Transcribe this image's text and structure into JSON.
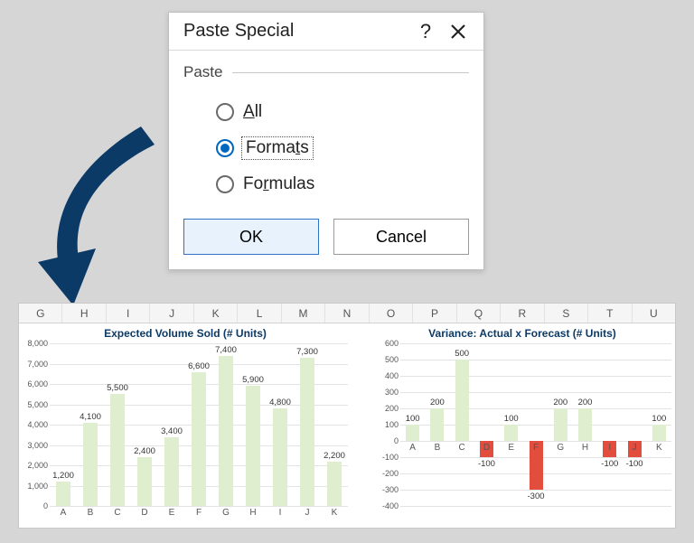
{
  "dialog": {
    "title": "Paste Special",
    "help_symbol": "?",
    "group_label": "Paste",
    "options": {
      "all": {
        "label": "All",
        "ukey": "A"
      },
      "formats": {
        "label": "Formats",
        "ukey": "t"
      },
      "formulas": {
        "label": "Formulas",
        "ukey": "r"
      }
    },
    "ok_label": "OK",
    "cancel_label": "Cancel"
  },
  "spreadsheet": {
    "columns": [
      "G",
      "H",
      "I",
      "J",
      "K",
      "L",
      "M",
      "N",
      "O",
      "P",
      "Q",
      "R",
      "S",
      "T",
      "U"
    ]
  },
  "chart_data": [
    {
      "id": "expected",
      "type": "bar",
      "title": "Expected Volume Sold (# Units)",
      "categories": [
        "A",
        "B",
        "C",
        "D",
        "E",
        "F",
        "G",
        "H",
        "I",
        "J",
        "K"
      ],
      "values": [
        1200,
        4100,
        5500,
        2400,
        3400,
        6600,
        7400,
        5900,
        4800,
        7300,
        2200
      ],
      "labels": [
        "1,200",
        "4,100",
        "5,500",
        "2,400",
        "3,400",
        "6,600",
        "7,400",
        "5,900",
        "4,800",
        "7,300",
        "2,200"
      ],
      "ylim": [
        0,
        8000
      ],
      "yticks": [
        0,
        1000,
        2000,
        3000,
        4000,
        5000,
        6000,
        7000,
        8000
      ],
      "ytick_labels": [
        "0",
        "1,000",
        "2,000",
        "3,000",
        "4,000",
        "5,000",
        "6,000",
        "7,000",
        "8,000"
      ]
    },
    {
      "id": "variance",
      "type": "bar",
      "title": "Variance: Actual x Forecast (# Units)",
      "categories": [
        "A",
        "B",
        "C",
        "D",
        "E",
        "F",
        "G",
        "H",
        "I",
        "J",
        "K"
      ],
      "values": [
        100,
        200,
        500,
        -100,
        100,
        -300,
        200,
        200,
        -100,
        -100,
        100
      ],
      "labels": [
        "100",
        "200",
        "500",
        "-100",
        "100",
        "-300",
        "200",
        "200",
        "-100",
        "-100",
        "100"
      ],
      "ylim": [
        -400,
        600
      ],
      "yticks": [
        -400,
        -300,
        -200,
        -100,
        0,
        100,
        200,
        300,
        400,
        500,
        600
      ],
      "ytick_labels": [
        "-400",
        "-300",
        "-200",
        "-100",
        "0",
        "100",
        "200",
        "300",
        "400",
        "500",
        "600"
      ]
    }
  ]
}
